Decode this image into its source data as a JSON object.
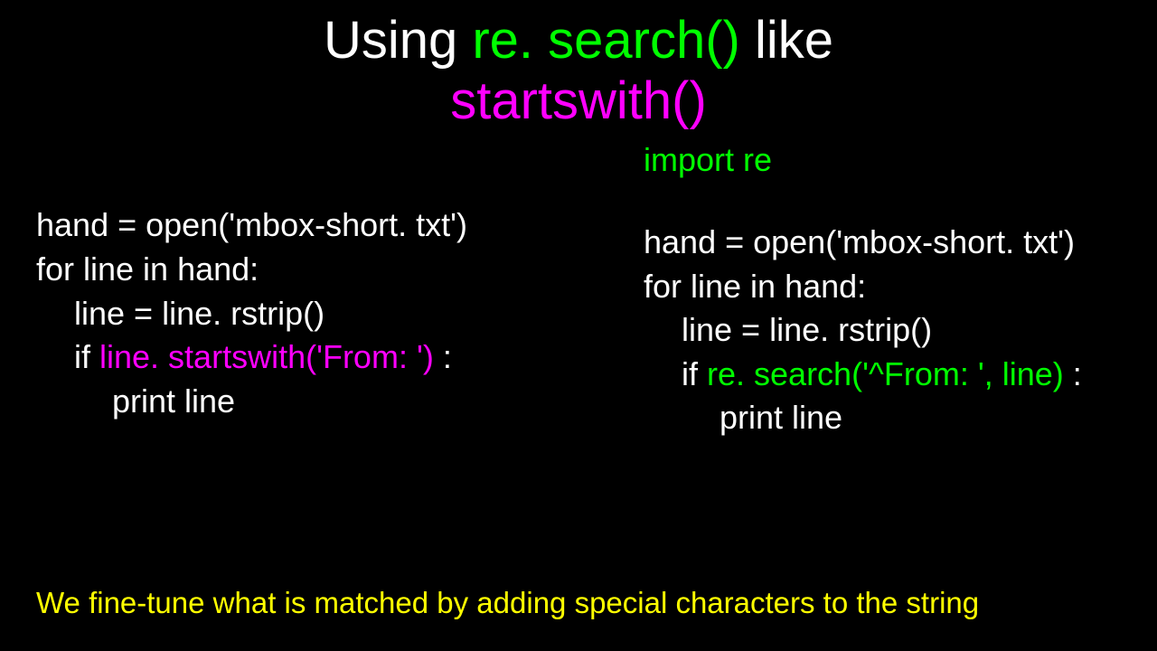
{
  "title": {
    "part1": "Using ",
    "part2": "re. search()",
    "part3": " like ",
    "part4": "startswith()"
  },
  "left_code": {
    "l1": "hand = open('mbox-short. txt')",
    "l2": "for line in hand:",
    "l3": "line = line. rstrip()",
    "l4a": "if ",
    "l4b": "line. startswith('From: ')",
    "l4c": " :",
    "l5": "print line"
  },
  "right_code": {
    "l0": "import re",
    "l1": "hand = open('mbox-short. txt')",
    "l2": "for line in hand:",
    "l3": "line = line. rstrip()",
    "l4a": "if ",
    "l4b": "re. search('^From: ', line)",
    "l4c": " :",
    "l5": "print line"
  },
  "footer": "We fine-tune what is matched by adding special characters to the string"
}
